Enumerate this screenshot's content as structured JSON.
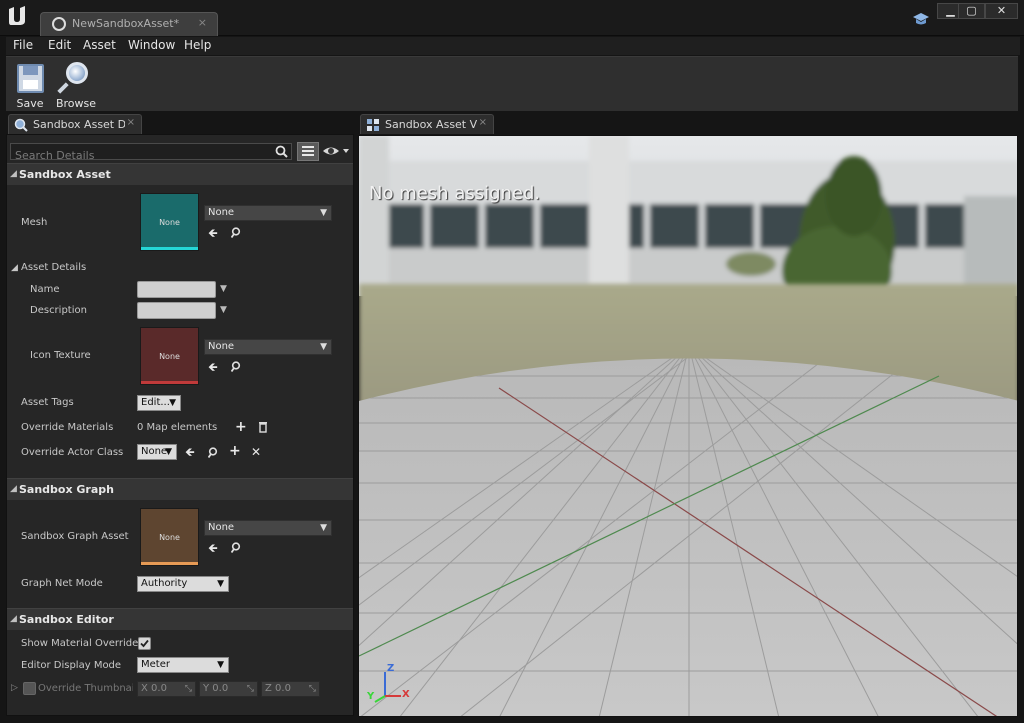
{
  "window": {
    "tab_title": "NewSandboxAsset*",
    "close_glyph": "×",
    "buttons": {
      "minimize": "▁",
      "maximize": "▢",
      "close": "✕"
    }
  },
  "menubar": [
    "File",
    "Edit",
    "Asset",
    "Window",
    "Help"
  ],
  "toolbar": {
    "save_label": "Save",
    "browse_label": "Browse"
  },
  "details_tab": {
    "label": "Sandbox Asset Det",
    "close": "×"
  },
  "viewport_tab": {
    "label": "Sandbox Asset Vie",
    "close": "×"
  },
  "search": {
    "placeholder": "Search Details"
  },
  "sections": {
    "sandbox_asset": {
      "title": "Sandbox Asset",
      "mesh": {
        "label": "Mesh",
        "thumb": "None",
        "value": "None",
        "color": "#1a6b6b",
        "accent": "#25d6d6"
      },
      "asset_details": {
        "title": "Asset Details",
        "name_label": "Name",
        "description_label": "Description",
        "icon_texture": {
          "label": "Icon Texture",
          "thumb": "None",
          "value": "None",
          "color": "#5a2a2a",
          "accent": "#c03a3a"
        },
        "asset_tags": {
          "label": "Asset Tags",
          "button": "Edit..."
        },
        "override_materials": {
          "label": "Override Materials",
          "value": "0 Map elements"
        },
        "override_actor_class": {
          "label": "Override Actor Class",
          "value": "None"
        }
      }
    },
    "sandbox_graph": {
      "title": "Sandbox Graph",
      "graph_asset": {
        "label": "Sandbox Graph Asset",
        "thumb": "None",
        "value": "None",
        "color": "#5e4530",
        "accent": "#e69a55"
      },
      "net_mode": {
        "label": "Graph Net Mode",
        "value": "Authority"
      }
    },
    "sandbox_editor": {
      "title": "Sandbox Editor",
      "show_material_overrides": {
        "label": "Show Material Overrides",
        "checked": true
      },
      "display_mode": {
        "label": "Editor Display Mode",
        "value": "Meter"
      },
      "override_thumbnail": {
        "label": "Override Thumbnail F",
        "x": {
          "axis": "X",
          "value": "0.0"
        },
        "y": {
          "axis": "Y",
          "value": "0.0"
        },
        "z": {
          "axis": "Z",
          "value": "0.0"
        }
      }
    }
  },
  "viewport": {
    "message": "No mesh assigned.",
    "axes": {
      "x": "X",
      "y": "Y",
      "z": "Z"
    }
  }
}
